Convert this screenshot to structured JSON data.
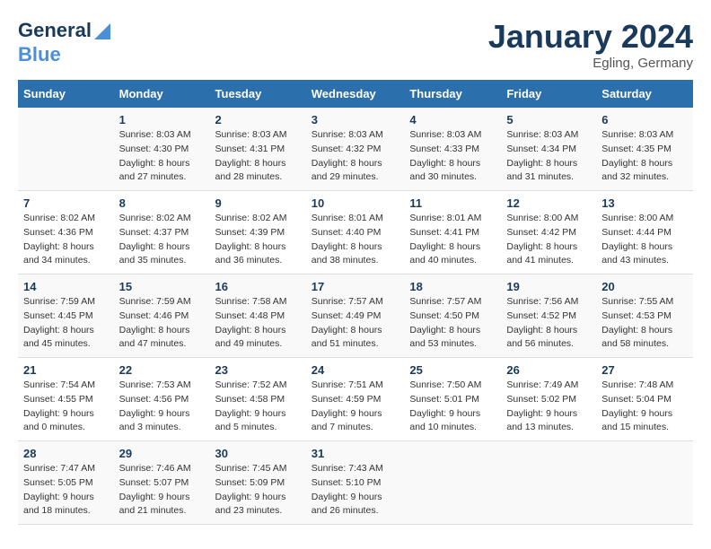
{
  "header": {
    "logo_line1": "General",
    "logo_line2": "Blue",
    "month": "January 2024",
    "location": "Egling, Germany"
  },
  "weekdays": [
    "Sunday",
    "Monday",
    "Tuesday",
    "Wednesday",
    "Thursday",
    "Friday",
    "Saturday"
  ],
  "weeks": [
    [
      {
        "day": "",
        "sunrise": "",
        "sunset": "",
        "daylight": ""
      },
      {
        "day": "1",
        "sunrise": "Sunrise: 8:03 AM",
        "sunset": "Sunset: 4:30 PM",
        "daylight": "Daylight: 8 hours and 27 minutes."
      },
      {
        "day": "2",
        "sunrise": "Sunrise: 8:03 AM",
        "sunset": "Sunset: 4:31 PM",
        "daylight": "Daylight: 8 hours and 28 minutes."
      },
      {
        "day": "3",
        "sunrise": "Sunrise: 8:03 AM",
        "sunset": "Sunset: 4:32 PM",
        "daylight": "Daylight: 8 hours and 29 minutes."
      },
      {
        "day": "4",
        "sunrise": "Sunrise: 8:03 AM",
        "sunset": "Sunset: 4:33 PM",
        "daylight": "Daylight: 8 hours and 30 minutes."
      },
      {
        "day": "5",
        "sunrise": "Sunrise: 8:03 AM",
        "sunset": "Sunset: 4:34 PM",
        "daylight": "Daylight: 8 hours and 31 minutes."
      },
      {
        "day": "6",
        "sunrise": "Sunrise: 8:03 AM",
        "sunset": "Sunset: 4:35 PM",
        "daylight": "Daylight: 8 hours and 32 minutes."
      }
    ],
    [
      {
        "day": "7",
        "sunrise": "Sunrise: 8:02 AM",
        "sunset": "Sunset: 4:36 PM",
        "daylight": "Daylight: 8 hours and 34 minutes."
      },
      {
        "day": "8",
        "sunrise": "Sunrise: 8:02 AM",
        "sunset": "Sunset: 4:37 PM",
        "daylight": "Daylight: 8 hours and 35 minutes."
      },
      {
        "day": "9",
        "sunrise": "Sunrise: 8:02 AM",
        "sunset": "Sunset: 4:39 PM",
        "daylight": "Daylight: 8 hours and 36 minutes."
      },
      {
        "day": "10",
        "sunrise": "Sunrise: 8:01 AM",
        "sunset": "Sunset: 4:40 PM",
        "daylight": "Daylight: 8 hours and 38 minutes."
      },
      {
        "day": "11",
        "sunrise": "Sunrise: 8:01 AM",
        "sunset": "Sunset: 4:41 PM",
        "daylight": "Daylight: 8 hours and 40 minutes."
      },
      {
        "day": "12",
        "sunrise": "Sunrise: 8:00 AM",
        "sunset": "Sunset: 4:42 PM",
        "daylight": "Daylight: 8 hours and 41 minutes."
      },
      {
        "day": "13",
        "sunrise": "Sunrise: 8:00 AM",
        "sunset": "Sunset: 4:44 PM",
        "daylight": "Daylight: 8 hours and 43 minutes."
      }
    ],
    [
      {
        "day": "14",
        "sunrise": "Sunrise: 7:59 AM",
        "sunset": "Sunset: 4:45 PM",
        "daylight": "Daylight: 8 hours and 45 minutes."
      },
      {
        "day": "15",
        "sunrise": "Sunrise: 7:59 AM",
        "sunset": "Sunset: 4:46 PM",
        "daylight": "Daylight: 8 hours and 47 minutes."
      },
      {
        "day": "16",
        "sunrise": "Sunrise: 7:58 AM",
        "sunset": "Sunset: 4:48 PM",
        "daylight": "Daylight: 8 hours and 49 minutes."
      },
      {
        "day": "17",
        "sunrise": "Sunrise: 7:57 AM",
        "sunset": "Sunset: 4:49 PM",
        "daylight": "Daylight: 8 hours and 51 minutes."
      },
      {
        "day": "18",
        "sunrise": "Sunrise: 7:57 AM",
        "sunset": "Sunset: 4:50 PM",
        "daylight": "Daylight: 8 hours and 53 minutes."
      },
      {
        "day": "19",
        "sunrise": "Sunrise: 7:56 AM",
        "sunset": "Sunset: 4:52 PM",
        "daylight": "Daylight: 8 hours and 56 minutes."
      },
      {
        "day": "20",
        "sunrise": "Sunrise: 7:55 AM",
        "sunset": "Sunset: 4:53 PM",
        "daylight": "Daylight: 8 hours and 58 minutes."
      }
    ],
    [
      {
        "day": "21",
        "sunrise": "Sunrise: 7:54 AM",
        "sunset": "Sunset: 4:55 PM",
        "daylight": "Daylight: 9 hours and 0 minutes."
      },
      {
        "day": "22",
        "sunrise": "Sunrise: 7:53 AM",
        "sunset": "Sunset: 4:56 PM",
        "daylight": "Daylight: 9 hours and 3 minutes."
      },
      {
        "day": "23",
        "sunrise": "Sunrise: 7:52 AM",
        "sunset": "Sunset: 4:58 PM",
        "daylight": "Daylight: 9 hours and 5 minutes."
      },
      {
        "day": "24",
        "sunrise": "Sunrise: 7:51 AM",
        "sunset": "Sunset: 4:59 PM",
        "daylight": "Daylight: 9 hours and 7 minutes."
      },
      {
        "day": "25",
        "sunrise": "Sunrise: 7:50 AM",
        "sunset": "Sunset: 5:01 PM",
        "daylight": "Daylight: 9 hours and 10 minutes."
      },
      {
        "day": "26",
        "sunrise": "Sunrise: 7:49 AM",
        "sunset": "Sunset: 5:02 PM",
        "daylight": "Daylight: 9 hours and 13 minutes."
      },
      {
        "day": "27",
        "sunrise": "Sunrise: 7:48 AM",
        "sunset": "Sunset: 5:04 PM",
        "daylight": "Daylight: 9 hours and 15 minutes."
      }
    ],
    [
      {
        "day": "28",
        "sunrise": "Sunrise: 7:47 AM",
        "sunset": "Sunset: 5:05 PM",
        "daylight": "Daylight: 9 hours and 18 minutes."
      },
      {
        "day": "29",
        "sunrise": "Sunrise: 7:46 AM",
        "sunset": "Sunset: 5:07 PM",
        "daylight": "Daylight: 9 hours and 21 minutes."
      },
      {
        "day": "30",
        "sunrise": "Sunrise: 7:45 AM",
        "sunset": "Sunset: 5:09 PM",
        "daylight": "Daylight: 9 hours and 23 minutes."
      },
      {
        "day": "31",
        "sunrise": "Sunrise: 7:43 AM",
        "sunset": "Sunset: 5:10 PM",
        "daylight": "Daylight: 9 hours and 26 minutes."
      },
      {
        "day": "",
        "sunrise": "",
        "sunset": "",
        "daylight": ""
      },
      {
        "day": "",
        "sunrise": "",
        "sunset": "",
        "daylight": ""
      },
      {
        "day": "",
        "sunrise": "",
        "sunset": "",
        "daylight": ""
      }
    ]
  ]
}
